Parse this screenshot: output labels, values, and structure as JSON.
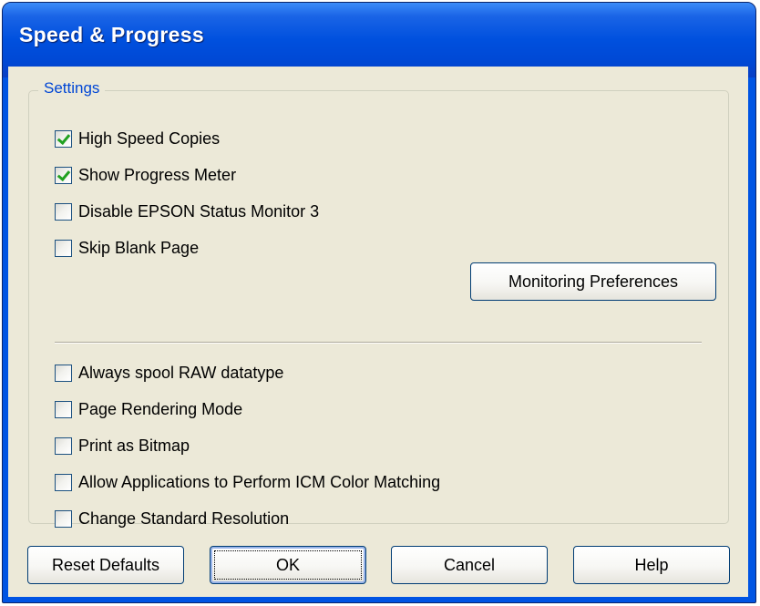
{
  "window": {
    "title": "Speed & Progress"
  },
  "settings": {
    "group_label": "Settings",
    "top_options": [
      {
        "label": "High Speed Copies",
        "checked": true
      },
      {
        "label": "Show Progress Meter",
        "checked": true
      },
      {
        "label": "Disable EPSON Status Monitor 3",
        "checked": false
      },
      {
        "label": "Skip Blank Page",
        "checked": false
      }
    ],
    "monitoring_button_label": "Monitoring Preferences",
    "bottom_options": [
      {
        "label": "Always spool RAW datatype",
        "checked": false
      },
      {
        "label": "Page Rendering Mode",
        "checked": false
      },
      {
        "label": "Print as Bitmap",
        "checked": false
      },
      {
        "label": "Allow Applications to Perform ICM Color Matching",
        "checked": false
      },
      {
        "label": "Change Standard Resolution",
        "checked": false
      }
    ]
  },
  "buttons": {
    "reset_defaults": "Reset Defaults",
    "ok": "OK",
    "cancel": "Cancel",
    "help": "Help"
  },
  "colors": {
    "titlebar": "#0050de",
    "client_background": "#ece9d8",
    "group_label": "#0046d5",
    "checkmark": "#21a121"
  }
}
